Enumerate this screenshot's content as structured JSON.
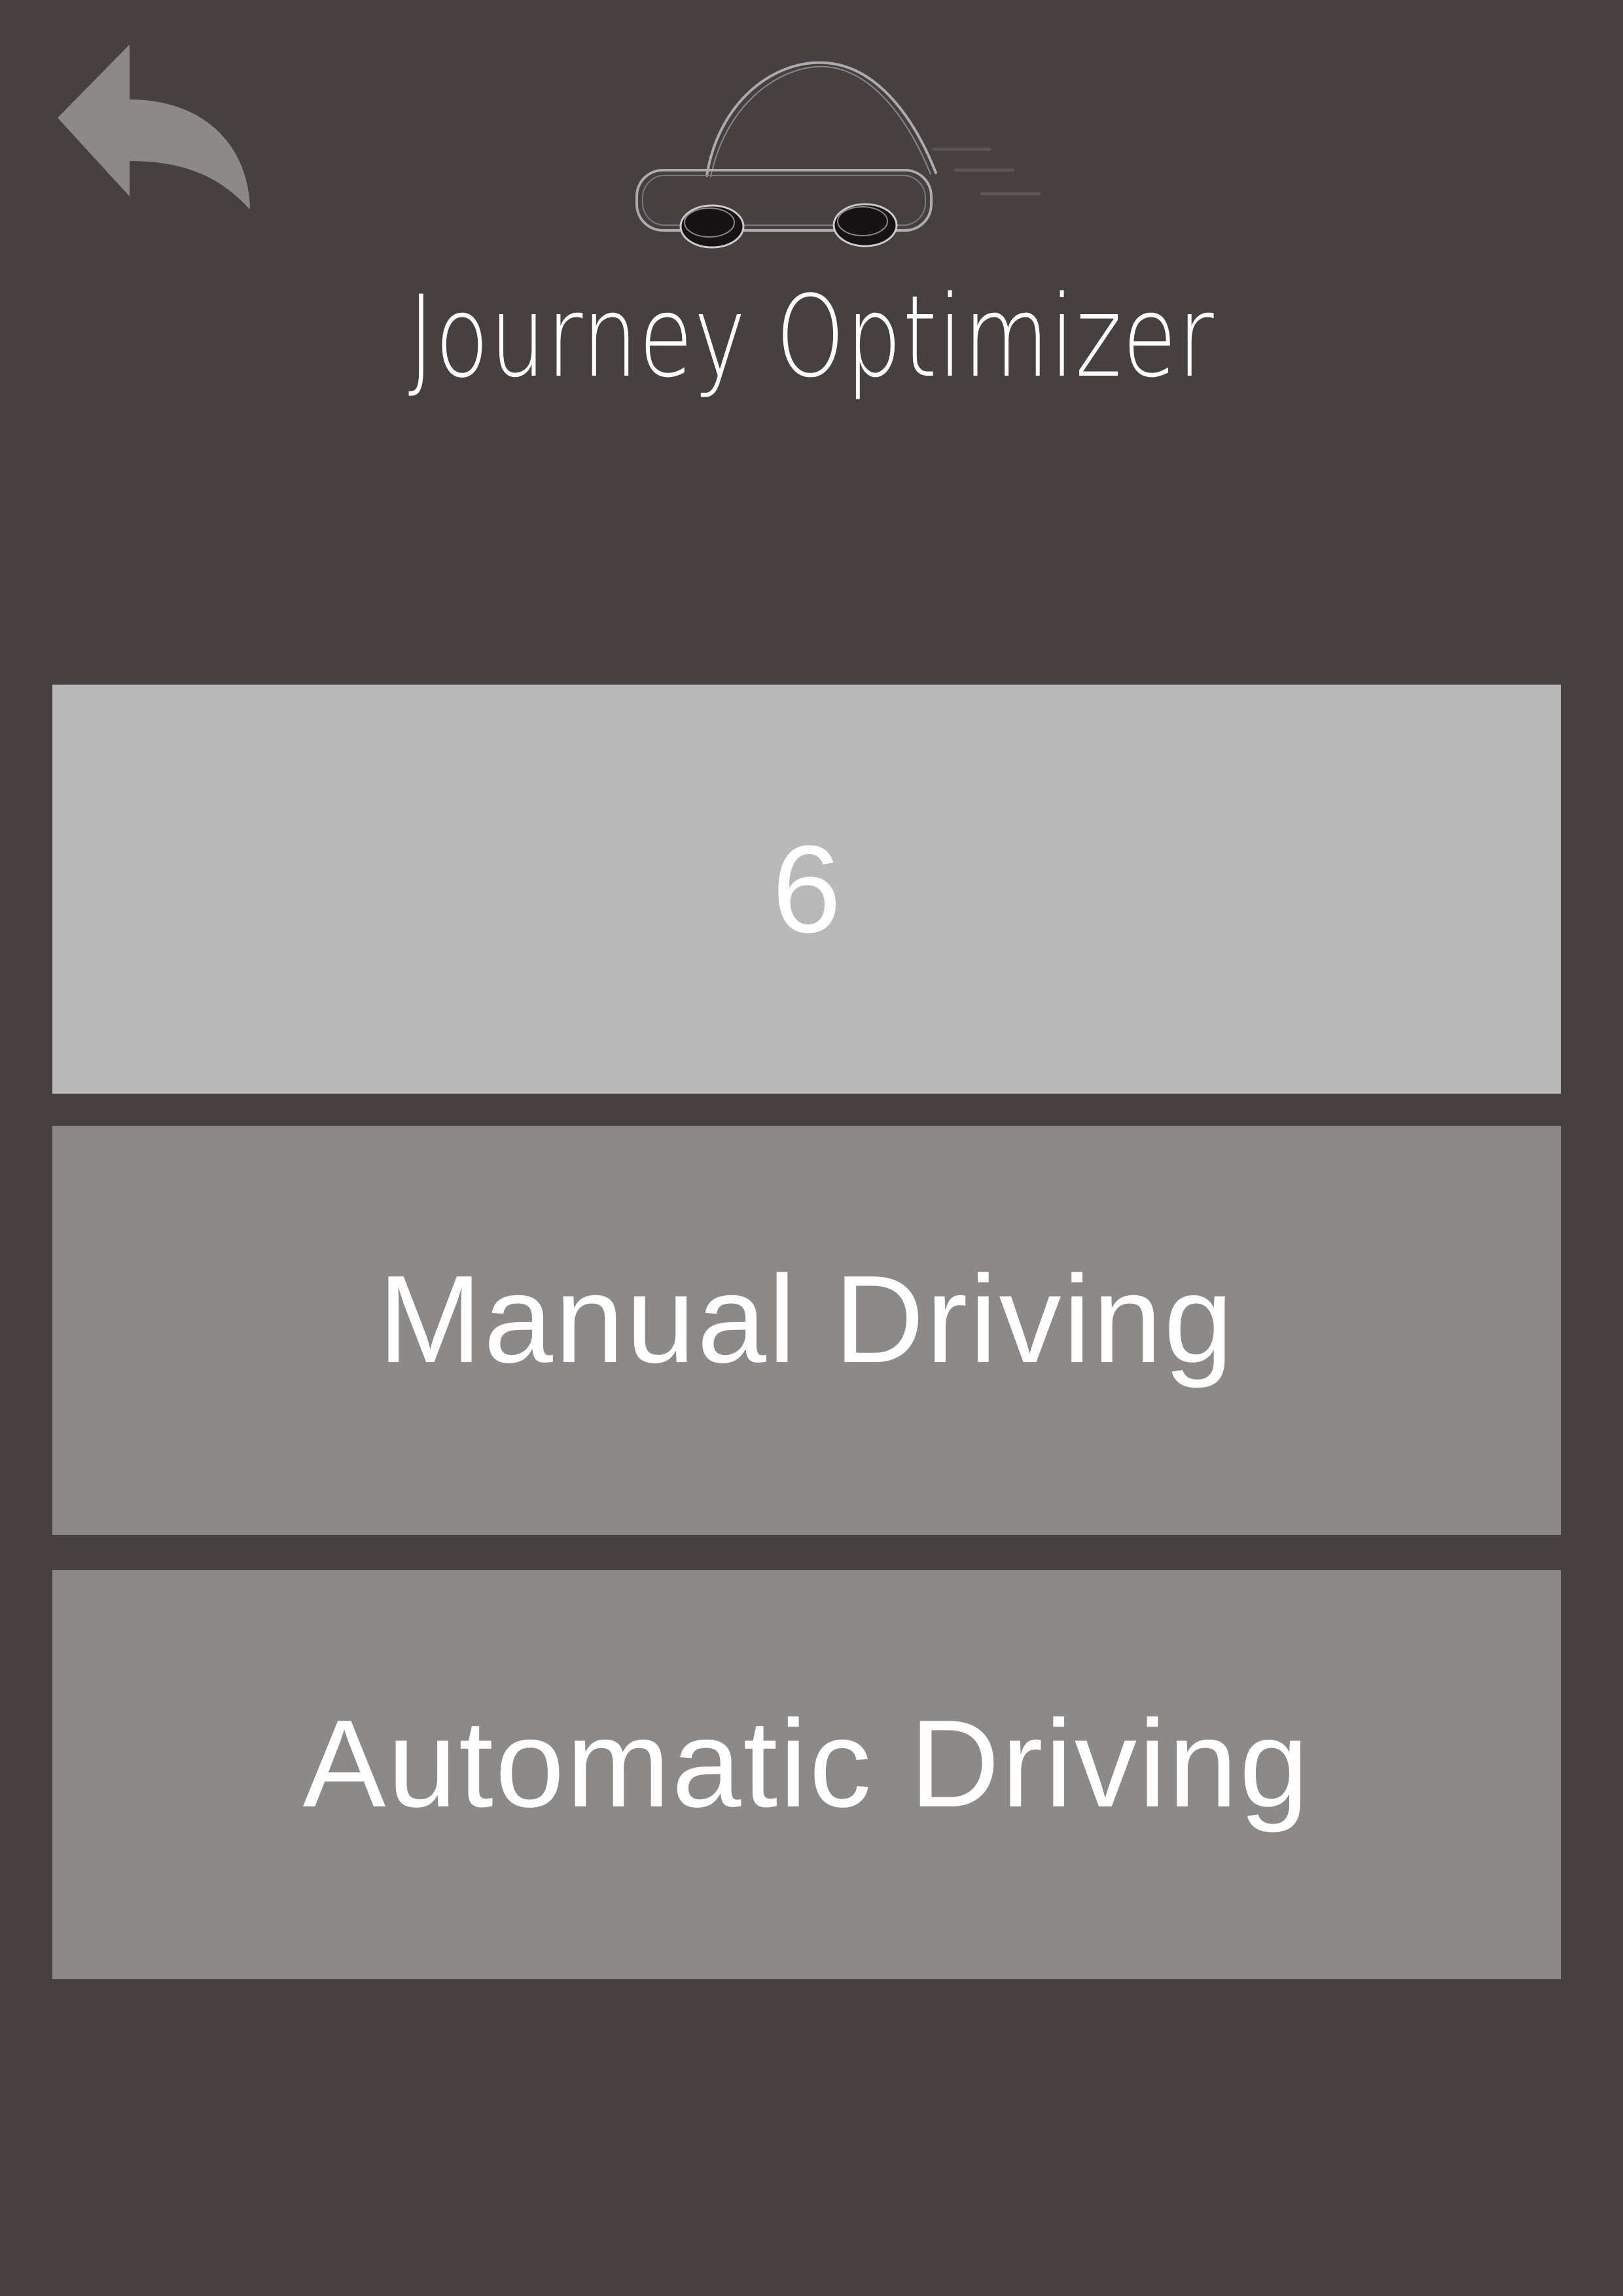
{
  "header": {
    "title": "Journey Optimizer",
    "back_icon": "back-arrow-icon",
    "logo_icon": "car-logo-icon"
  },
  "counter": {
    "value": "6"
  },
  "modes": {
    "manual_label": "Manual Driving",
    "automatic_label": "Automatic Driving"
  },
  "colors": {
    "background": "#464041",
    "counter_panel": "#bab9ba",
    "mode_button": "#8b8a88",
    "back_icon": "#8b8a88",
    "text": "#ffffff"
  }
}
